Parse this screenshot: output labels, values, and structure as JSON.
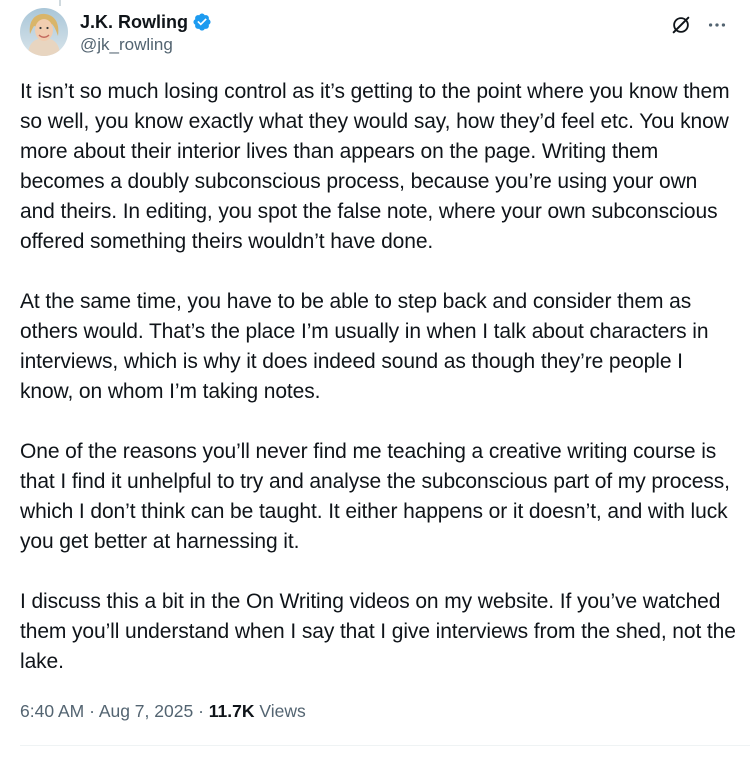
{
  "author": {
    "display_name": "J.K. Rowling",
    "handle": "@jk_rowling",
    "verified": true,
    "verified_color": "#1d9bf0"
  },
  "actions": {
    "grok_icon": "grok-slash-icon",
    "more_icon": "more-dots-icon"
  },
  "tweet": {
    "paragraphs": [
      "It isn’t so much losing control as it’s getting to the point where you know them so well, you know exactly what they would say, how they’d feel etc. You know more about their interior lives than appears on the page. Writing them becomes a doubly subconscious process, because you’re using your own and theirs. In editing, you spot the false note, where your own subconscious offered something theirs wouldn’t have done.",
      "At the same time, you have to be able to step back and consider them as others would. That’s the place I’m usually in when I talk about characters in interviews, which is why it does indeed sound as though they’re people I know, on whom I’m taking notes.",
      "One of the reasons you’ll never find me teaching a creative writing course is that I find it unhelpful to try and analyse the subconscious part of my process, which I don’t think can be taught. It either happens or it doesn’t, and with luck you get better at harnessing it.",
      "I discuss this a bit in the On Writing videos on my website. If you’ve watched them you’ll understand when I say that I give interviews from the shed, not the lake."
    ]
  },
  "meta": {
    "time": "6:40 AM",
    "separator": " · ",
    "date": "Aug 7, 2025",
    "views_count": "11.7K",
    "views_label": " Views"
  },
  "colors": {
    "text": "#0f1419",
    "secondary": "#536471",
    "divider": "#eff3f4"
  }
}
